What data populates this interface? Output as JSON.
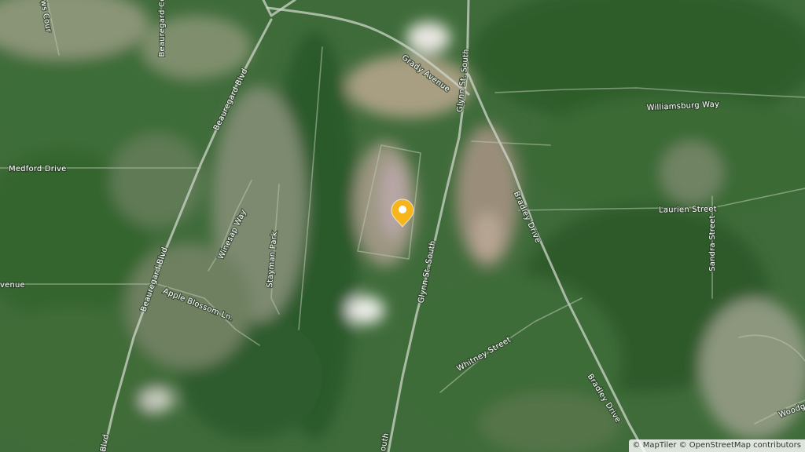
{
  "map": {
    "street_labels": {
      "grady_avenue": "Grady Avenue",
      "glynn_st_south_top": "Glynn St. South",
      "glynn_st_south_mid": "Glynn St. South",
      "glynn_st_south_bottom": "outh",
      "williamsburg_way": "Williamsburg Way",
      "beauregard_blvd_top": "Beauregard Blvd",
      "beauregard_blvd_mid": "Beauregard Blvd",
      "beauregard_blvd_bottom": "Blvd",
      "beauregard_court": "Beauregard Co",
      "lows_court": "ows Cour",
      "medford_drive": "Medford Drive",
      "winesap_way": "Winesap Way",
      "stayman_park": "Stayman Park",
      "apple_blossom_ln": "Apple Blossom Ln.",
      "avenue_left": "venue",
      "laurien_street": "Laurien Street",
      "sandra_street": "Sandra Street",
      "bradley_drive_top": "Bradley Drive",
      "bradley_drive_bottom": "Bradley Drive",
      "whitney_street": "Whitney Street",
      "woodg": "Woodg"
    },
    "marker": {
      "icon": "map-pin-icon",
      "color": "#f5b51b"
    },
    "attribution": "© MapTiler © OpenStreetMap contributors"
  }
}
